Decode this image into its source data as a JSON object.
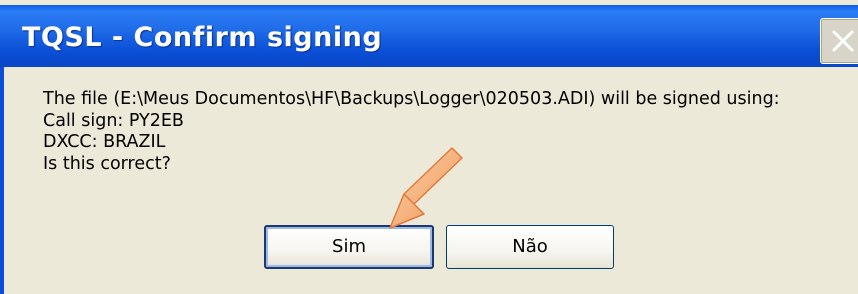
{
  "window": {
    "title": "TQSL - Confirm signing"
  },
  "message": {
    "line1": "The file (E:\\Meus Documentos\\HF\\Backups\\Logger\\020503.ADI) will be signed using:",
    "line2": "Call sign: PY2EB",
    "line3": "DXCC: BRAZIL",
    "line4": "Is this correct?"
  },
  "buttons": {
    "yes_label": "Sim",
    "no_label": "Não"
  },
  "colors": {
    "titlebar": "#0a4fd6",
    "dialog_bg": "#ece9d8",
    "annotation_arrow": "#f4a460"
  },
  "icons": {
    "close": "close-icon",
    "annotation": "annotation-arrow-icon"
  }
}
